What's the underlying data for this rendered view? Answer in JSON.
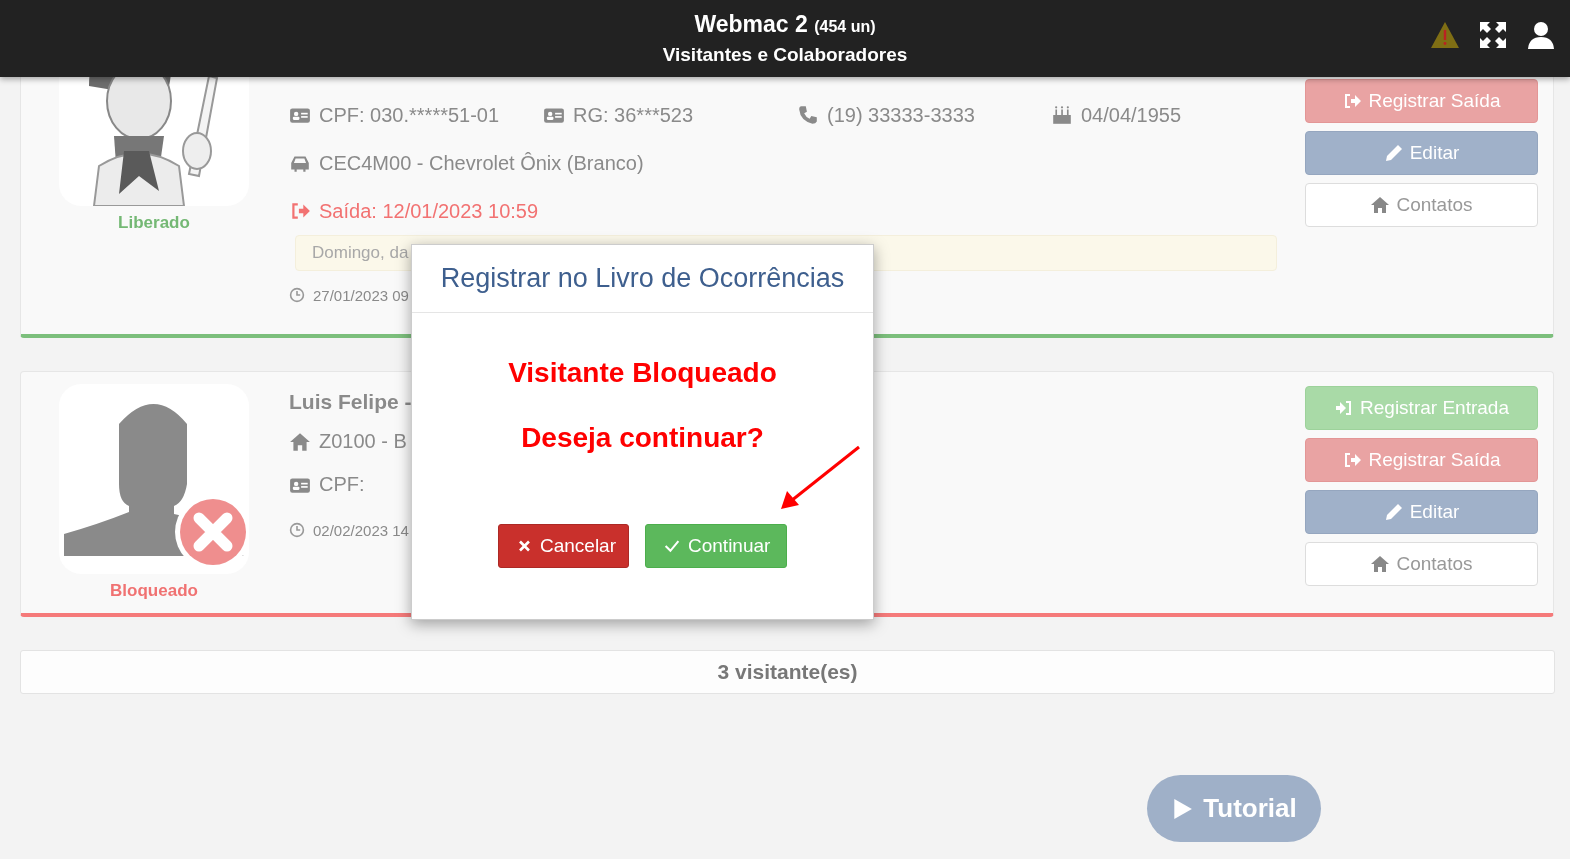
{
  "header": {
    "title": "Webmac 2",
    "count": "(454 un)",
    "subtitle": "Visitantes e Colaboradores"
  },
  "visitors": [
    {
      "status": {
        "label": "Liberado",
        "kind": "released"
      },
      "lines": [
        {
          "kind": "info",
          "items": [
            {
              "kind": "cpf",
              "text": "CPF: 030.*****51-01"
            },
            {
              "kind": "rg",
              "text": "RG: 36***523"
            },
            {
              "kind": "phone",
              "text": "(19) 33333-3333"
            },
            {
              "kind": "birthdate",
              "text": "04/04/1955"
            }
          ]
        },
        {
          "kind": "info",
          "items": [
            {
              "kind": "vehicle",
              "text": "CEC4M00 - Chevrolet Ônix (Branco)"
            }
          ]
        },
        {
          "kind": "exit",
          "items": [
            {
              "kind": "exit",
              "text": "Saída: 12/01/2023 10:59"
            }
          ]
        },
        {
          "kind": "note",
          "items": [
            {
              "text": "Domingo, da"
            }
          ]
        },
        {
          "kind": "time",
          "items": [
            {
              "kind": "time",
              "text": "27/01/2023 09"
            }
          ]
        }
      ],
      "buttons": [
        {
          "kind": "exit",
          "label": "Registrar Saída"
        },
        {
          "kind": "edit",
          "label": "Editar"
        },
        {
          "kind": "contacts",
          "label": "Contatos"
        }
      ]
    },
    {
      "status": {
        "label": "Bloqueado",
        "kind": "blocked"
      },
      "lines": [
        {
          "kind": "name",
          "items": [
            {
              "text": "Luis Felipe -"
            }
          ]
        },
        {
          "kind": "info",
          "items": [
            {
              "kind": "address",
              "text": "Z0100 - B"
            }
          ]
        },
        {
          "kind": "info",
          "items": [
            {
              "kind": "cpf",
              "text": "CPF:"
            }
          ]
        },
        {
          "kind": "time",
          "items": [
            {
              "kind": "time",
              "text": "02/02/2023 14"
            }
          ]
        }
      ],
      "buttons": [
        {
          "kind": "entry",
          "label": "Registrar Entrada"
        },
        {
          "kind": "exit",
          "label": "Registrar Saída"
        },
        {
          "kind": "edit",
          "label": "Editar"
        },
        {
          "kind": "contacts",
          "label": "Contatos"
        }
      ]
    }
  ],
  "footer": {
    "count": "3 visitante(es)"
  },
  "modal": {
    "title": "Registrar no Livro de Ocorrências",
    "messages": [
      "Visitante Bloqueado",
      "Deseja continuar?"
    ],
    "buttons": [
      {
        "kind": "cancel",
        "label": "Cancelar"
      },
      {
        "kind": "confirm",
        "label": "Continuar"
      }
    ]
  },
  "tutorial": {
    "label": "Tutorial"
  }
}
